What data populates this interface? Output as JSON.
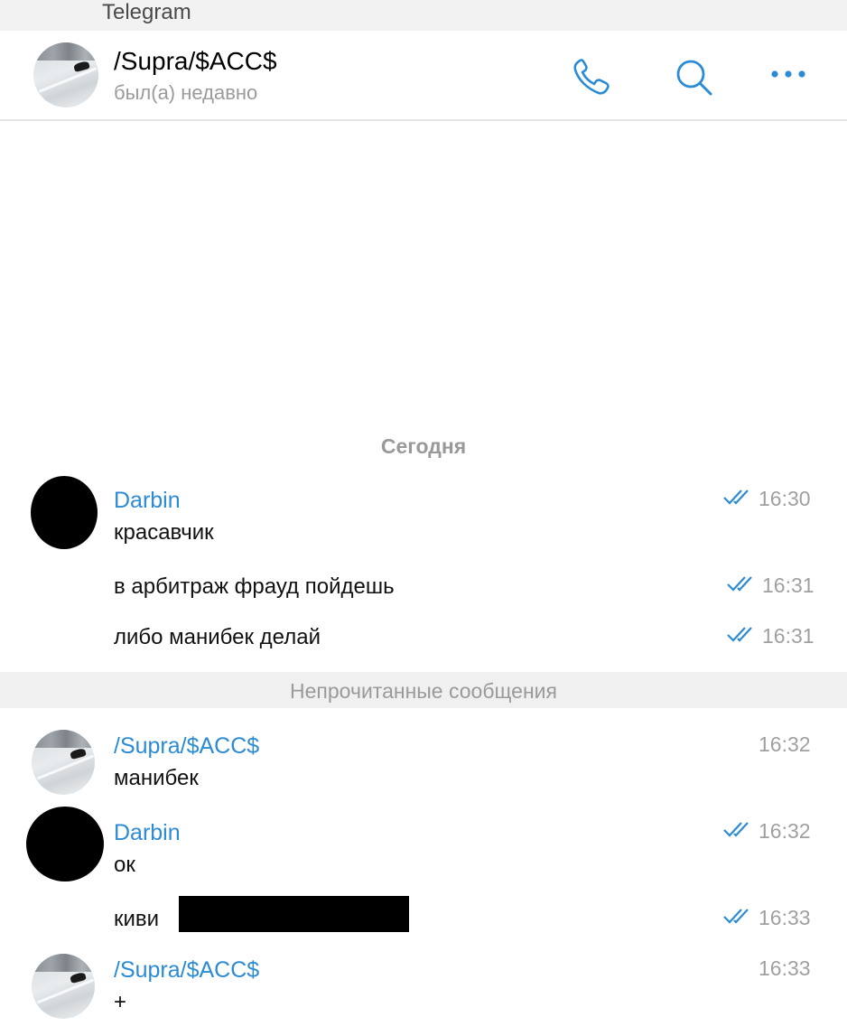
{
  "window": {
    "app_title": "Telegram"
  },
  "header": {
    "chat_name": "/Supra/$ACC$",
    "status": "был(а) недавно",
    "icons": [
      "phone-icon",
      "search-icon",
      "more-icon"
    ]
  },
  "colors": {
    "accent": "#2b8bd5",
    "secondary_text": "#9b9b9b",
    "unread_bar": "#f0f0f0"
  },
  "date_separator": "Сегодня",
  "unread_label": "Непрочитанные сообщения",
  "messages": [
    {
      "sender": "Darbin",
      "text": "красавчик",
      "time": "16:30",
      "read": true
    },
    {
      "text": "в арбитраж фрауд пойдешь",
      "time": "16:31",
      "read": true
    },
    {
      "text": "либо манибек делай",
      "time": "16:31",
      "read": true
    },
    {
      "sender": "/Supra/$ACC$",
      "text": "манибек",
      "time": "16:32"
    },
    {
      "sender": "Darbin",
      "text": "ок",
      "time": "16:32",
      "read": true
    },
    {
      "text": "киви",
      "time": "16:33",
      "read": true,
      "redacted": true
    },
    {
      "sender": "/Supra/$ACC$",
      "text": "+",
      "time": "16:33"
    }
  ]
}
